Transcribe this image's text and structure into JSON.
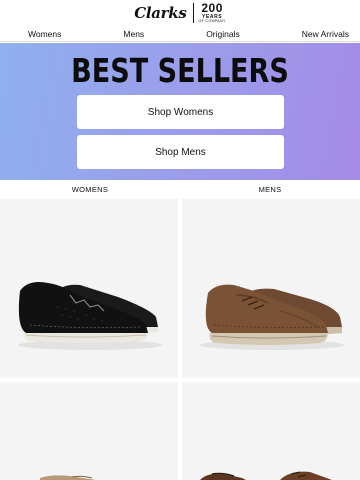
{
  "brand": {
    "logo_text": "Clarks",
    "anniversary_number": "200",
    "anniversary_label": "YEARS",
    "anniversary_sub": "OF COMPANY"
  },
  "nav": {
    "items": [
      "Womens",
      "Mens",
      "Originals",
      "New Arrivals"
    ]
  },
  "hero": {
    "title": "BEST SELLERS",
    "buttons": [
      "Shop Womens",
      "Shop Mens"
    ]
  },
  "sections": {
    "left_label": "WOMENS",
    "right_label": "MENS"
  },
  "products": [
    {
      "icon": "black-sneaker-image"
    },
    {
      "icon": "brown-lace-up-shoe-image"
    },
    {
      "icon": "tan-shoe-image"
    },
    {
      "icon": "brown-shoe-image"
    }
  ],
  "colors": {
    "hero_gradient_start": "#8fb0ee",
    "hero_gradient_end": "#a48be6",
    "tile_background": "#f4f4f4"
  }
}
